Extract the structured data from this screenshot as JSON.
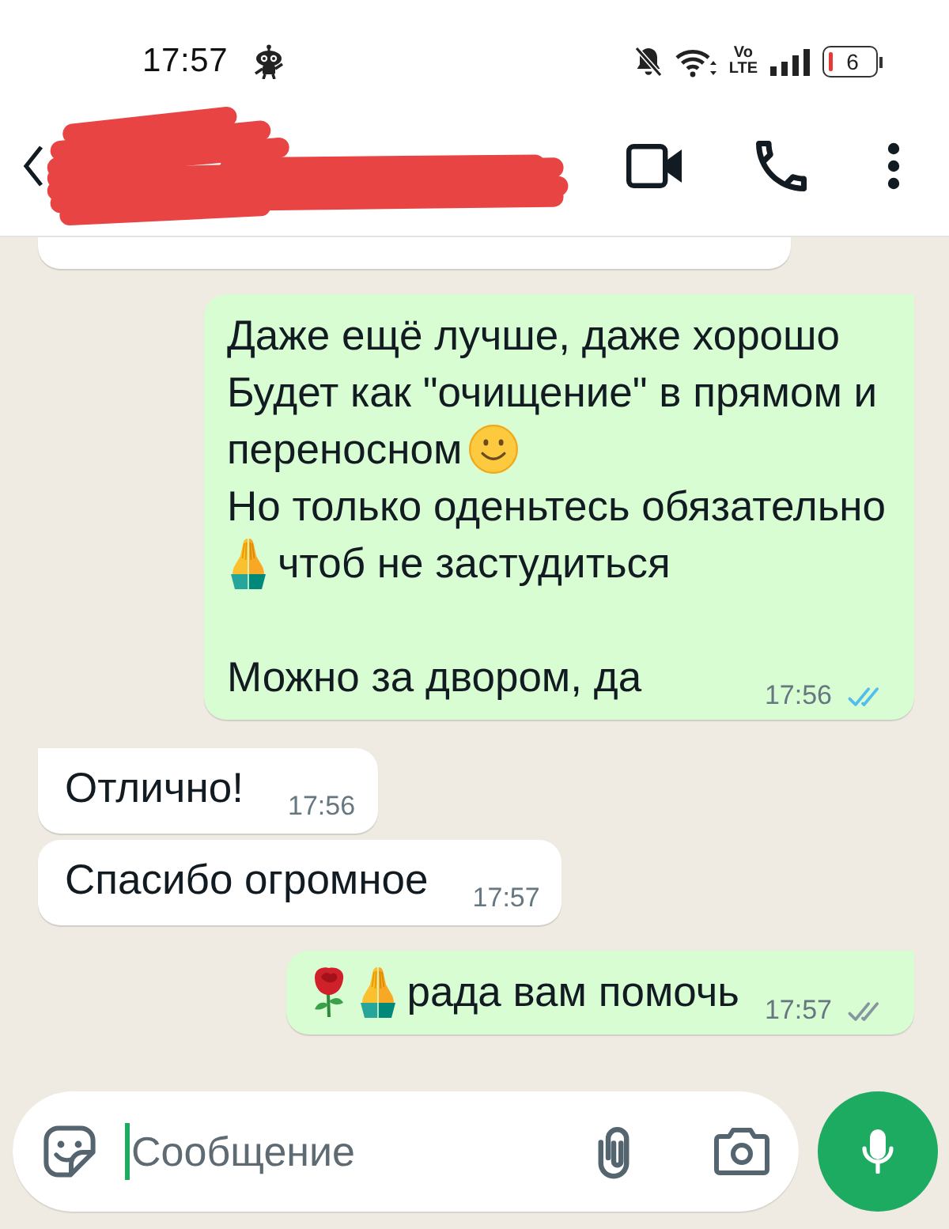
{
  "status_bar": {
    "time": "17:57",
    "network_type": [
      "Vo",
      "LTE"
    ],
    "battery": "6"
  },
  "messages": [
    {
      "kind": "clipped",
      "outgoing": false
    },
    {
      "kind": "message",
      "outgoing": true,
      "tail": true,
      "lines": [
        {
          "kind": "line",
          "parts": [
            {
              "kind": "text",
              "text": "Даже ещё лучше, даже хорошо"
            }
          ]
        },
        {
          "kind": "line",
          "parts": [
            {
              "kind": "text",
              "text": "Будет как \"очищение\" в прямом и"
            }
          ]
        },
        {
          "kind": "line",
          "parts": [
            {
              "kind": "text",
              "text": "переносном"
            },
            {
              "kind": "smiley"
            }
          ]
        },
        {
          "kind": "line",
          "parts": [
            {
              "kind": "text",
              "text": "Но только оденьтесь обязательно"
            }
          ]
        },
        {
          "kind": "line",
          "parts": [
            {
              "kind": "prayer"
            },
            {
              "kind": "text",
              "text": "чтоб не застудиться"
            }
          ]
        },
        {
          "kind": "spacer"
        },
        {
          "kind": "line",
          "parts": [
            {
              "kind": "text",
              "text": "Можно за двором, да"
            }
          ]
        }
      ],
      "time": "17:56",
      "read": true
    },
    {
      "kind": "message",
      "outgoing": false,
      "tail": true,
      "lines": [
        {
          "kind": "line",
          "parts": [
            {
              "kind": "text",
              "text": "Отлично!"
            }
          ]
        }
      ],
      "time": "17:56"
    },
    {
      "kind": "message",
      "outgoing": false,
      "tail": false,
      "lines": [
        {
          "kind": "line",
          "parts": [
            {
              "kind": "text",
              "text": "Спасибо огромное"
            }
          ]
        }
      ],
      "time": "17:57"
    },
    {
      "kind": "message",
      "outgoing": true,
      "tail": true,
      "lines": [
        {
          "kind": "line",
          "parts": [
            {
              "kind": "rose"
            },
            {
              "kind": "prayer"
            },
            {
              "kind": "text",
              "text": "рада вам помочь"
            }
          ]
        }
      ],
      "time": "17:57",
      "read": false
    }
  ],
  "composer": {
    "placeholder": "Сообщение",
    "focused": true
  }
}
